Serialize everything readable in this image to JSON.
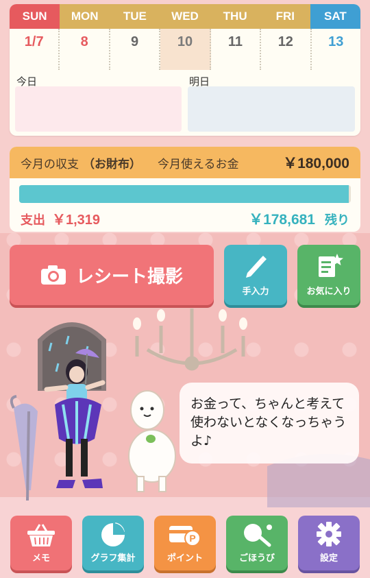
{
  "calendar": {
    "weekdays": [
      "SUN",
      "MON",
      "TUE",
      "WED",
      "THU",
      "FRI",
      "SAT"
    ],
    "dates": [
      "1/7",
      "8",
      "9",
      "10",
      "11",
      "12",
      "13"
    ],
    "today_label": "今日",
    "tomorrow_label": "明日",
    "colors": {
      "sun": "#e65a5e",
      "sat": "#3f9fd3",
      "weekday": "#d9b25e",
      "today_bg": "#f8e3cf"
    }
  },
  "budget": {
    "title": "今月の収支",
    "wallet_label": "（お財布）",
    "available_label": "今月使えるお金",
    "available_amount": "￥180,000",
    "spent_label": "支出",
    "spent_amount": "￥1,319",
    "remaining_amount": "￥178,681",
    "remaining_label": "残り",
    "remaining_fraction": 0.993
  },
  "actions": {
    "receipt_label": "レシート撮影",
    "manual_label": "手入力",
    "favorites_label": "お気に入り"
  },
  "speech": {
    "text": "お金って、ちゃんと考えて使わないとなくなっちゃうよ♪"
  },
  "nav": {
    "memo": "メモ",
    "graph": "グラフ集計",
    "point": "ポイント",
    "reward": "ごほうび",
    "settings": "設定"
  }
}
